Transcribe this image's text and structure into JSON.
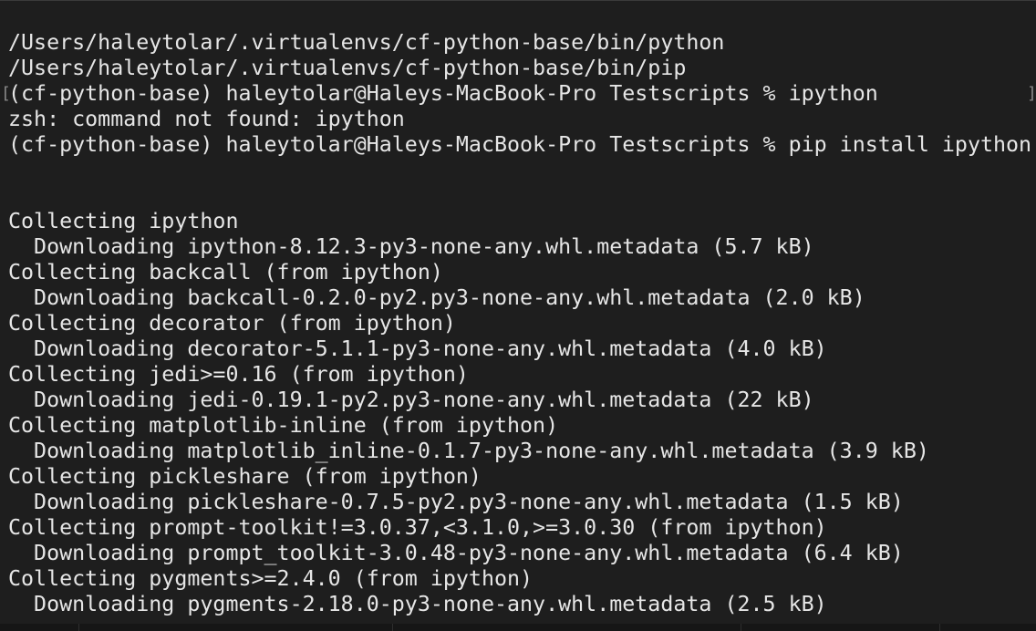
{
  "terminal": {
    "lines": [
      "/Users/haleytolar/.virtualenvs/cf-python-base/bin/python",
      "/Users/haleytolar/.virtualenvs/cf-python-base/bin/pip",
      "(cf-python-base) haleytolar@Haleys-MacBook-Pro Testscripts % ipython",
      "zsh: command not found: ipython",
      "(cf-python-base) haleytolar@Haleys-MacBook-Pro Testscripts % pip install ipython",
      "",
      "",
      "Collecting ipython",
      "  Downloading ipython-8.12.3-py3-none-any.whl.metadata (5.7 kB)",
      "Collecting backcall (from ipython)",
      "  Downloading backcall-0.2.0-py2.py3-none-any.whl.metadata (2.0 kB)",
      "Collecting decorator (from ipython)",
      "  Downloading decorator-5.1.1-py3-none-any.whl.metadata (4.0 kB)",
      "Collecting jedi>=0.16 (from ipython)",
      "  Downloading jedi-0.19.1-py2.py3-none-any.whl.metadata (22 kB)",
      "Collecting matplotlib-inline (from ipython)",
      "  Downloading matplotlib_inline-0.1.7-py3-none-any.whl.metadata (3.9 kB)",
      "Collecting pickleshare (from ipython)",
      "  Downloading pickleshare-0.7.5-py2.py3-none-any.whl.metadata (1.5 kB)",
      "Collecting prompt-toolkit!=3.0.37,<3.1.0,>=3.0.30 (from ipython)",
      "  Downloading prompt_toolkit-3.0.48-py3-none-any.whl.metadata (6.4 kB)",
      "Collecting pygments>=2.4.0 (from ipython)",
      "  Downloading pygments-2.18.0-py3-none-any.whl.metadata (2.5 kB)"
    ]
  },
  "marks": {
    "left": "[",
    "right": "]"
  },
  "colors": {
    "background": "#1e1e1e",
    "text": "#e6e6e6"
  }
}
